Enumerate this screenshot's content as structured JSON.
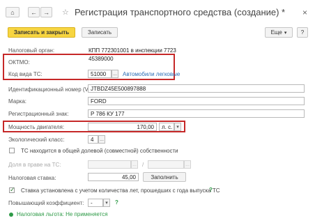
{
  "window": {
    "title": "Регистрация транспортного средства (создание) *",
    "nav": {
      "home": "⌂",
      "back": "←",
      "forward": "→"
    },
    "close": "×",
    "favorite": "☆"
  },
  "toolbar": {
    "save_close_label": "Записать и закрыть",
    "save_label": "Записать",
    "more_label": "Еще",
    "more_arrow": "▾",
    "help_label": "?"
  },
  "form": {
    "tax_authority": {
      "label": "Налоговый орган:",
      "value": "КПП 772301001 в инспекции 7723"
    },
    "oktmo": {
      "label": "ОКТМО:",
      "value": "45389000"
    },
    "vehicle_code": {
      "label": "Код вида ТС:",
      "value": "51000",
      "button": "...",
      "link": "Автомобили легковые"
    },
    "vin": {
      "label": "Идентификационный номер (VIN):",
      "value": "JTBDZ45E500897888"
    },
    "brand": {
      "label": "Марка:",
      "value": "FORD"
    },
    "reg_sign": {
      "label": "Регистрационный знак:",
      "value": "Р 786 КУ 177"
    },
    "engine_power": {
      "label": "Мощность двигателя:",
      "value": "170,00",
      "unit": "л. с.",
      "unit_arrow": "▾"
    },
    "eco_class": {
      "label": "Экологический класс:",
      "value": "4",
      "button": "..."
    },
    "shared_property": {
      "label": "ТС находится в общей долевой (совместной) собственности",
      "checked": false
    },
    "share": {
      "label": "Доля в праве на ТС:",
      "numerator": "",
      "separator": "/",
      "denominator": "",
      "button": "..."
    },
    "tax_rate": {
      "label": "Налоговая ставка:",
      "value": "45,00",
      "fill_button": "Заполнить"
    },
    "rate_by_age": {
      "label": "Ставка установлена с учетом количества лет, прошедших с года выпуска ТС",
      "checked": true,
      "hint": "?"
    },
    "multiplier": {
      "label": "Повышающий коэффициент:",
      "value": "-",
      "arrow": "▾",
      "hint": "?"
    },
    "tax_benefit": {
      "link": "Налоговая льгота: Не применяется"
    }
  },
  "colors": {
    "accent": "#f7d541",
    "highlight": "#c62828",
    "link": "#2a6db5",
    "hint": "#2e9a47"
  }
}
